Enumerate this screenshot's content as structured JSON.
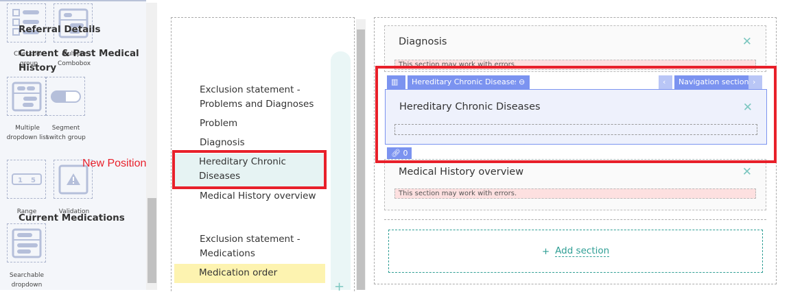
{
  "palette": {
    "items": [
      {
        "label": "Checkbox group",
        "icon": "checkbox-group-icon"
      },
      {
        "label": "Multiple Combobox",
        "icon": "multiple-combobox-icon"
      },
      {
        "label": "Multiple dropdown list",
        "icon": "multiple-dropdown-icon"
      },
      {
        "label": "Segment switch group",
        "icon": "segment-switch-icon"
      },
      {
        "label": "Range",
        "icon": "range-icon",
        "range_from": "1",
        "range_to": "5"
      },
      {
        "label": "Validation",
        "icon": "warning-icon"
      },
      {
        "label": "Searchable dropdown",
        "icon": "searchable-dropdown-icon"
      }
    ]
  },
  "annotation": "New Position",
  "nav": {
    "items": [
      {
        "label": "Referral Details",
        "level": "heading"
      },
      {
        "label": "Current & Past Medical History",
        "level": "heading"
      },
      {
        "label": "Exclusion statement - Problems and Diagnoses",
        "level": "sub"
      },
      {
        "label": "Problem",
        "level": "sub"
      },
      {
        "label": "Diagnosis",
        "level": "sub"
      },
      {
        "label": "Hereditary Chronic Diseases",
        "level": "sub",
        "state": "selected"
      },
      {
        "label": "Medical History overview",
        "level": "sub"
      },
      {
        "label": "Current Medications",
        "level": "heading"
      },
      {
        "label": "Exclusion statement - Medications",
        "level": "sub"
      },
      {
        "label": "Medication order",
        "level": "sub",
        "state": "highlighted"
      }
    ],
    "add_icon": "+"
  },
  "canvas": {
    "sections": [
      {
        "title": "Diagnosis",
        "warning": "This section may work with errors."
      },
      {
        "title": "Hereditary Chronic Diseases",
        "selected": true
      },
      {
        "title": "Medical History overview",
        "warning": "This section may work with errors."
      }
    ],
    "toolbar": {
      "name": "Hereditary Chronic Diseases",
      "nav_label": "Navigation section",
      "link_count": "0"
    },
    "add_section": "Add section"
  },
  "colors": {
    "accent": "#7b93f0",
    "teal": "#2e9e94",
    "annotation": "#e8202a",
    "selected_bg": "#e6f3f3",
    "highlight_bg": "#fdf3b0"
  }
}
